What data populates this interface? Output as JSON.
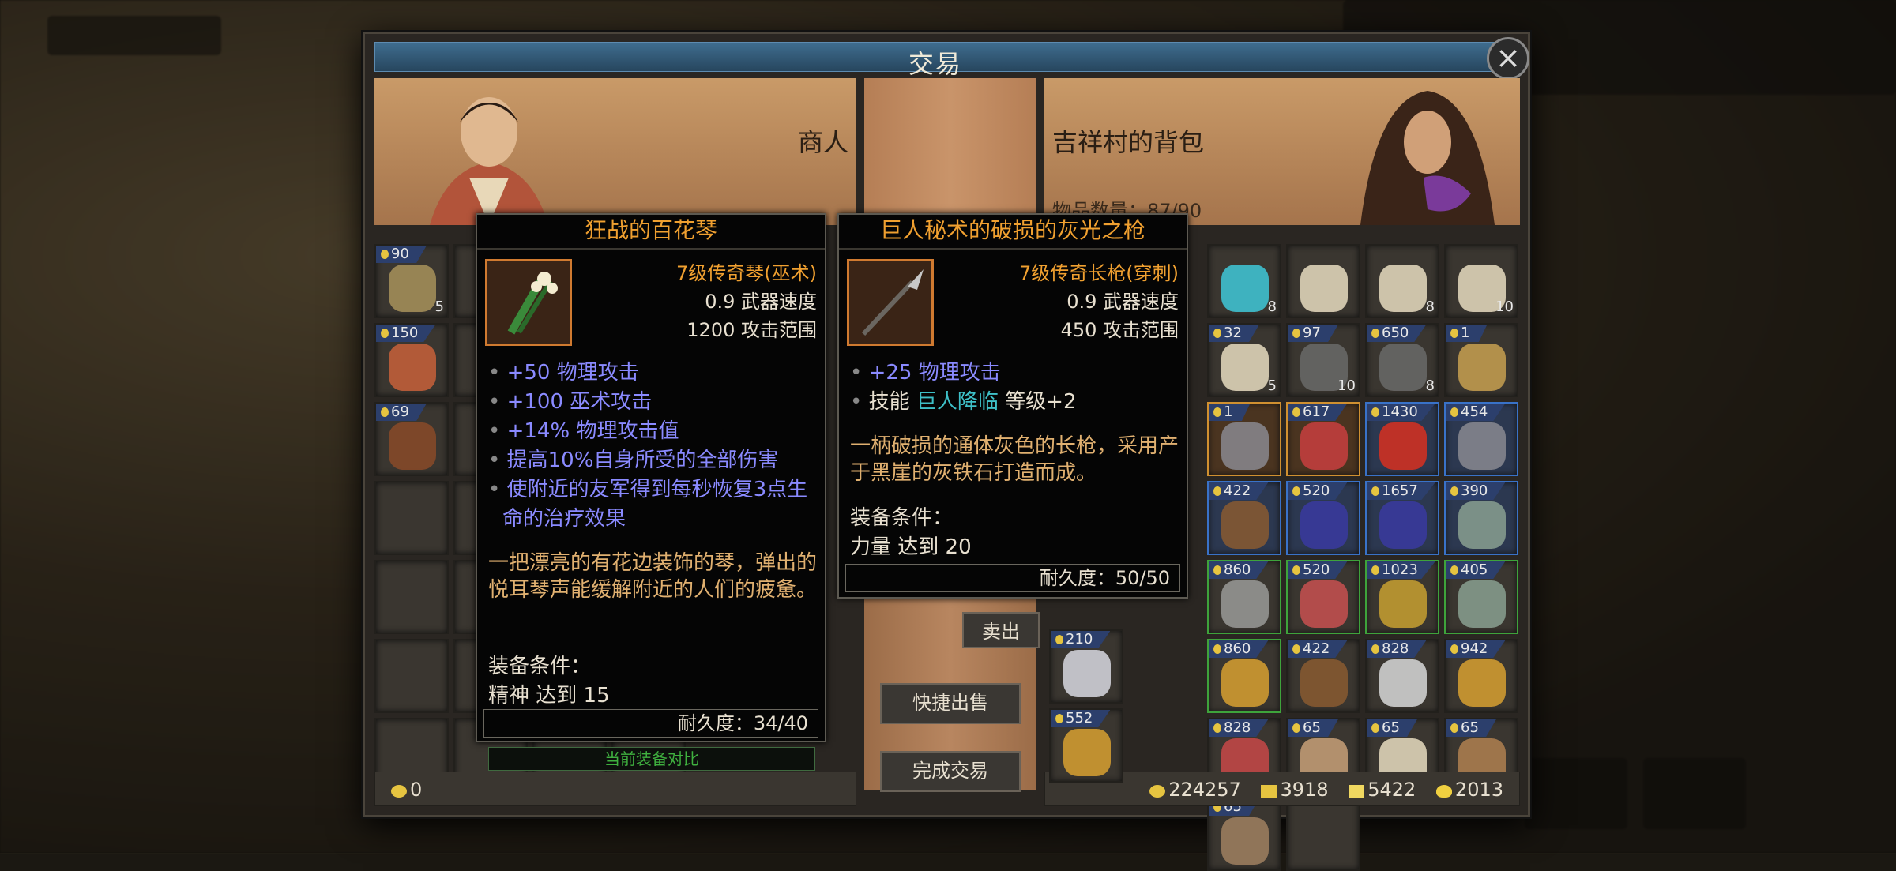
{
  "dialog": {
    "title": "交易",
    "close": "×"
  },
  "merchant": {
    "label": "商人",
    "gold": "0"
  },
  "bag": {
    "label": "吉祥村的背包",
    "count": "物品数量：87/90"
  },
  "currency": {
    "gold": "224257",
    "ingot": "3918",
    "bar": "5422",
    "coin": "2013"
  },
  "buttons": {
    "sell": "卖出",
    "quick_sell": "快捷出售",
    "finish": "完成交易"
  },
  "compare_label": "当前装备对比",
  "merchant_slots": [
    {
      "price": "90",
      "qty": "5",
      "icon": "money-bag-icon"
    },
    {
      "price": "150",
      "qty": "",
      "icon": "meat-skewer-icon"
    },
    {
      "price": "69",
      "qty": "",
      "icon": "wood-logs-icon"
    }
  ],
  "bag_slots": [
    {
      "price": "",
      "qty": "8",
      "icon": "crystal-icon",
      "frame": ""
    },
    {
      "price": "",
      "qty": "",
      "icon": "scroll-icon",
      "frame": ""
    },
    {
      "price": "",
      "qty": "8",
      "icon": "scroll-icon",
      "frame": ""
    },
    {
      "price": "",
      "qty": "10",
      "icon": "scroll-icon",
      "frame": ""
    },
    {
      "price": "32",
      "qty": "5",
      "icon": "scroll-icon",
      "frame": ""
    },
    {
      "price": "97",
      "qty": "10",
      "icon": "hammer-icon",
      "frame": ""
    },
    {
      "price": "650",
      "qty": "8",
      "icon": "hammer-icon",
      "frame": ""
    },
    {
      "price": "1",
      "qty": "",
      "icon": "bowl-icon",
      "frame": ""
    },
    {
      "price": "1",
      "qty": "",
      "icon": "spear-icon",
      "frame": "gold"
    },
    {
      "price": "617",
      "qty": "",
      "icon": "banner-icon",
      "frame": "gold"
    },
    {
      "price": "1430",
      "qty": "",
      "icon": "red-blade-icon",
      "frame": "blue"
    },
    {
      "price": "454",
      "qty": "",
      "icon": "spear-icon",
      "frame": "blue"
    },
    {
      "price": "422",
      "qty": "",
      "icon": "bow-icon",
      "frame": "blue"
    },
    {
      "price": "520",
      "qty": "",
      "icon": "staff-icon",
      "frame": "blue"
    },
    {
      "price": "1657",
      "qty": "",
      "icon": "staff-icon",
      "frame": "blue"
    },
    {
      "price": "390",
      "qty": "",
      "icon": "armor-icon",
      "frame": "blue"
    },
    {
      "price": "860",
      "qty": "",
      "icon": "sword-icon",
      "frame": "green"
    },
    {
      "price": "520",
      "qty": "",
      "icon": "claw-icon",
      "frame": "green"
    },
    {
      "price": "1023",
      "qty": "",
      "icon": "robe-icon",
      "frame": "green"
    },
    {
      "price": "405",
      "qty": "",
      "icon": "armor-icon",
      "frame": "green"
    },
    {
      "price": "860",
      "qty": "",
      "icon": "ring-icon",
      "frame": "green"
    },
    {
      "price": "422",
      "qty": "",
      "icon": "bow-icon",
      "frame": ""
    },
    {
      "price": "828",
      "qty": "",
      "icon": "flower-icon",
      "frame": ""
    },
    {
      "price": "942",
      "qty": "",
      "icon": "ring-icon",
      "frame": ""
    },
    {
      "price": "828",
      "qty": "",
      "icon": "ribbon-icon",
      "frame": ""
    },
    {
      "price": "65",
      "qty": "",
      "icon": "book-icon",
      "frame": ""
    },
    {
      "price": "65",
      "qty": "",
      "icon": "scroll-icon",
      "frame": ""
    },
    {
      "price": "65",
      "qty": "",
      "icon": "map-icon",
      "frame": ""
    },
    {
      "price": "65",
      "qty": "",
      "icon": "cloth-icon",
      "frame": ""
    }
  ],
  "bag_left_partial": [
    {
      "price": "210",
      "icon": "necklace-icon"
    },
    {
      "price": "552",
      "icon": "ring-icon"
    }
  ],
  "tooltip_left": {
    "name": "狂战的百花琴",
    "quality": "7级传奇琴(巫术)",
    "speed": "0.9 武器速度",
    "range": "1200 攻击范围",
    "bonuses": [
      "+50 物理攻击",
      "+100 巫术攻击",
      "+14% 物理攻击值",
      "提高10%自身所受的全部伤害",
      "使附近的友军得到每秒恢复3点生命的治疗效果"
    ],
    "desc": "一把漂亮的有花边装饰的琴，弹出的悦耳琴声能缓解附近的人们的疲惫。",
    "req_title": "装备条件：",
    "req": "精神 达到 15",
    "durability": "耐久度：34/40"
  },
  "tooltip_right": {
    "name": "巨人秘术的破损的灰光之枪",
    "quality": "7级传奇长枪(穿刺)",
    "speed": "0.9 武器速度",
    "range": "450 攻击范围",
    "bonuses": [
      "+25 物理攻击"
    ],
    "skill_prefix": "技能 ",
    "skill_name": "巨人降临",
    "skill_suffix": " 等级+2",
    "desc": "一柄破损的通体灰色的长枪，采用产于黑崖的灰铁石打造而成。",
    "req_title": "装备条件：",
    "req": "力量 达到 20",
    "durability": "耐久度：50/50"
  }
}
